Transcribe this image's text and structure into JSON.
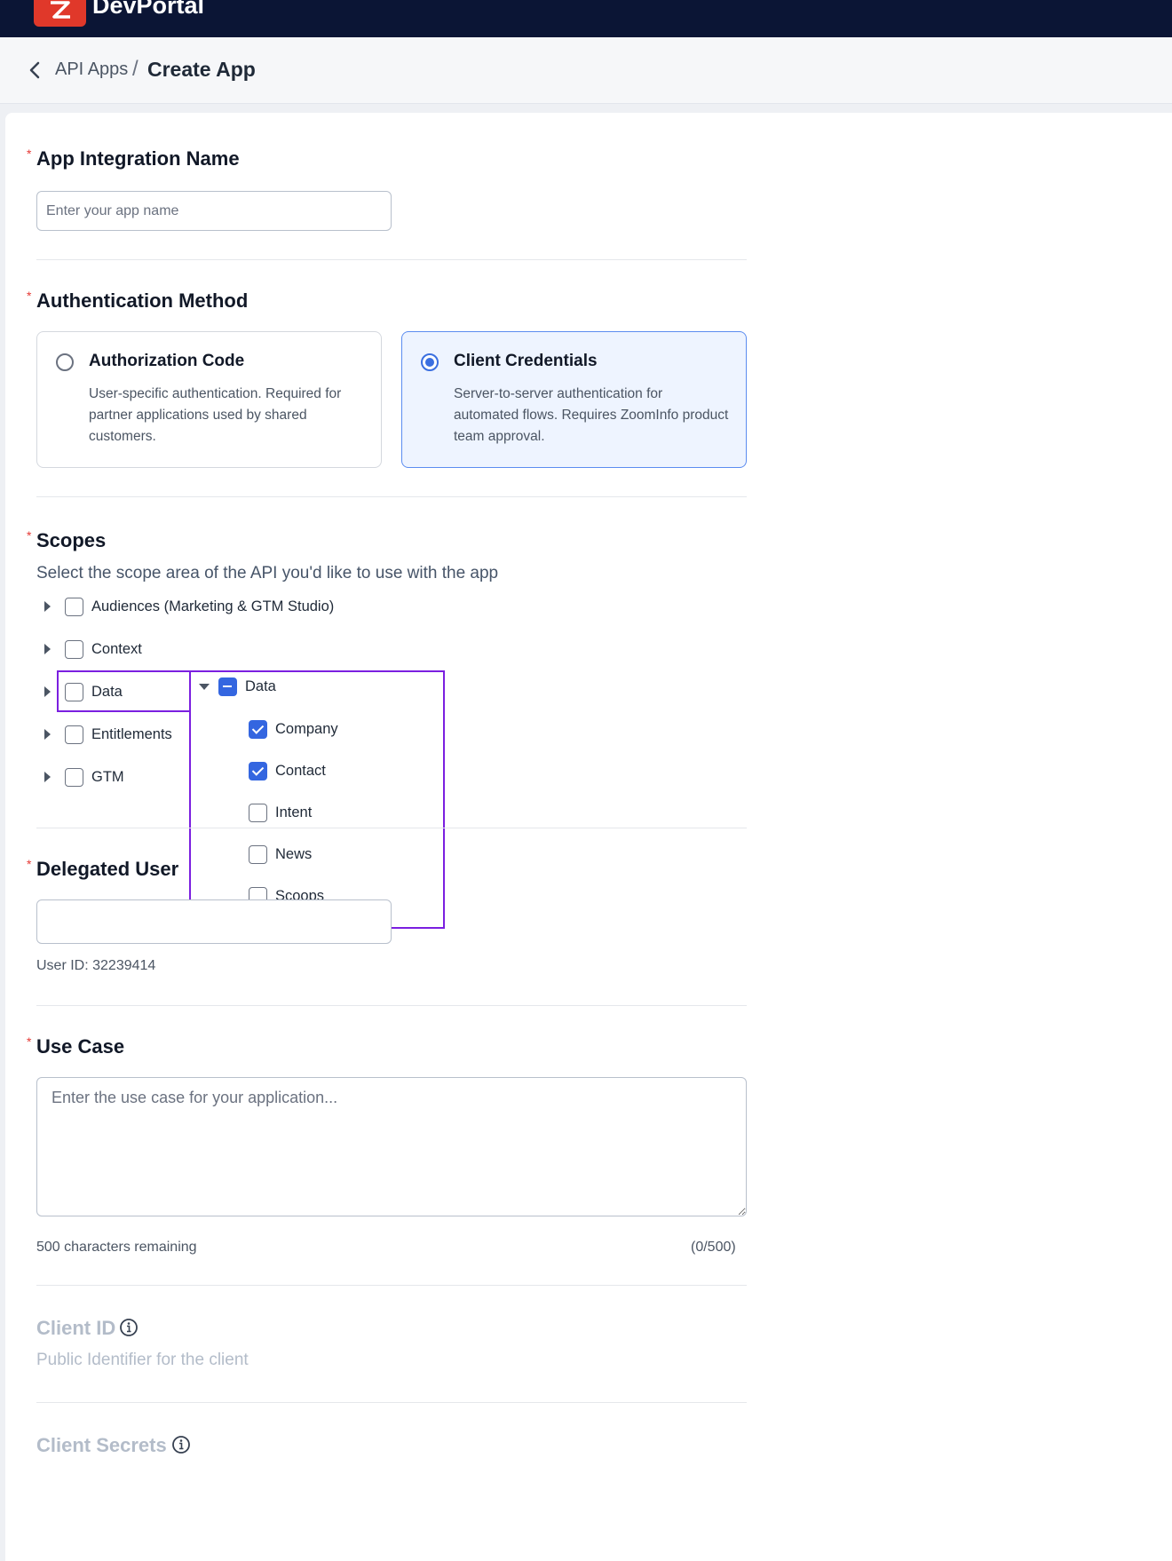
{
  "app": {
    "brand": "DevPortal"
  },
  "breadcrumb": {
    "parent": "API Apps",
    "separator": "/",
    "current": "Create App"
  },
  "form": {
    "app_name": {
      "label": "App Integration Name",
      "placeholder": "Enter your app name",
      "value": ""
    },
    "auth": {
      "label": "Authentication Method",
      "options": [
        {
          "title": "Authorization Code",
          "desc": "User-specific authentication. Required for partner applications used by shared customers.",
          "selected": false
        },
        {
          "title": "Client Credentials",
          "desc": "Server-to-server authentication for automated flows. Requires ZoomInfo product team approval.",
          "selected": true
        }
      ]
    },
    "scopes": {
      "label": "Scopes",
      "hint": "Select the scope area of the API you'd like to use with the app",
      "items": [
        {
          "label": "Audiences (Marketing & GTM Studio)",
          "checked": false
        },
        {
          "label": "Context",
          "checked": false
        },
        {
          "label": "Data",
          "checked": false
        },
        {
          "label": "Entitlements",
          "checked": false
        },
        {
          "label": "GTM",
          "checked": false
        }
      ],
      "expanded": {
        "label": "Data",
        "state": "indeterminate",
        "children": [
          {
            "label": "Company",
            "checked": true
          },
          {
            "label": "Contact",
            "checked": true
          },
          {
            "label": "Intent",
            "checked": false
          },
          {
            "label": "News",
            "checked": false
          },
          {
            "label": "Scoops",
            "checked": false
          }
        ]
      }
    },
    "delegated_user": {
      "label": "Delegated User",
      "value": "",
      "user_id": "User ID: 32239414"
    },
    "use_case": {
      "label": "Use Case",
      "placeholder": "Enter the use case for your application...",
      "remaining": "500 characters remaining",
      "count": "(0/500)"
    },
    "client_id": {
      "label": "Client ID",
      "desc": "Public Identifier for the client"
    },
    "client_secrets": {
      "label": "Client Secrets"
    }
  },
  "colors": {
    "brand_red": "#e0382a",
    "topbar": "#0b1535",
    "accent": "#3466e0",
    "highlight": "#7b1fe0"
  }
}
